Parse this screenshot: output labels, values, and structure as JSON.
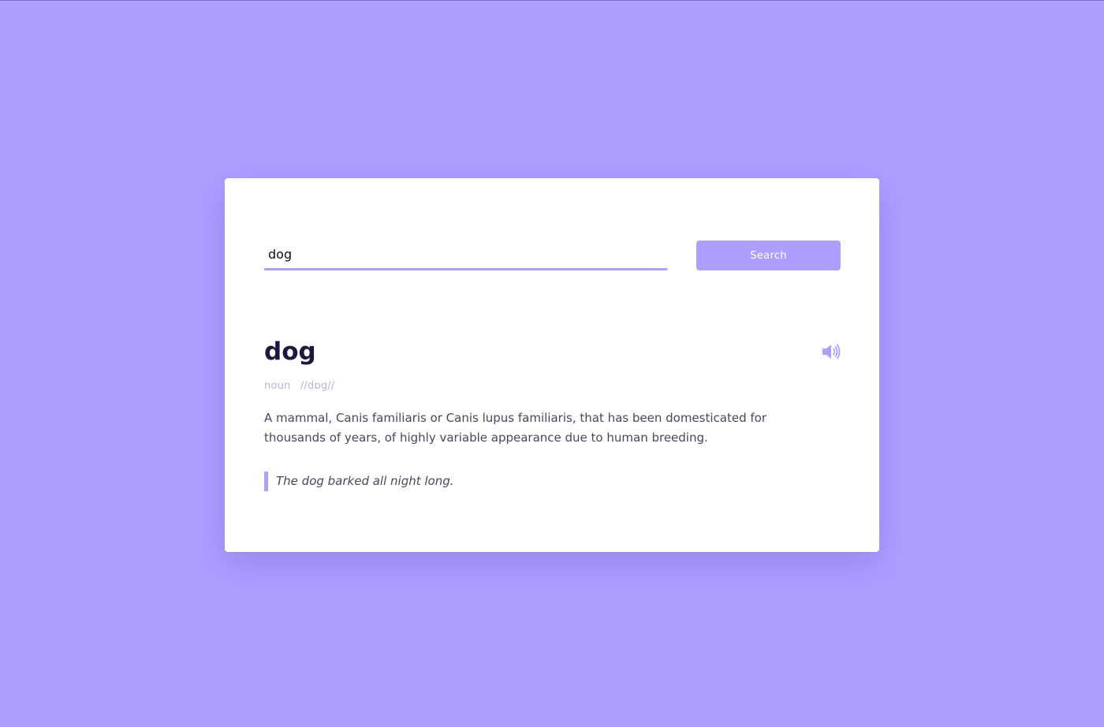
{
  "search": {
    "value": "dog",
    "button_label": "Search"
  },
  "result": {
    "word": "dog",
    "part_of_speech": "noun",
    "phonetic": "//dɒg//",
    "definition": "A mammal, Canis familiaris or Canis lupus familiaris, that has been domesticated for thousands of years, of highly variable appearance due to human breeding.",
    "example": "The dog barked all night long.",
    "audio_icon": "speaker-icon"
  },
  "colors": {
    "background": "#ae9eff",
    "accent": "#ae9eff",
    "card": "#ffffff",
    "word_text": "#1e1840"
  }
}
